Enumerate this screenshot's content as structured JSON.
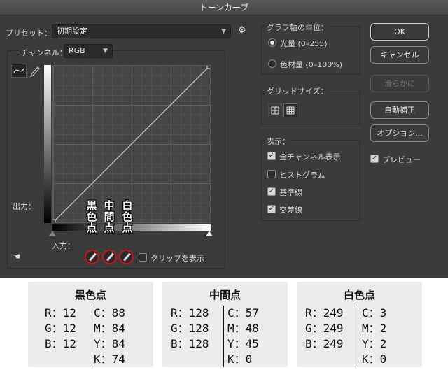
{
  "dialog": {
    "title": "トーンカーブ",
    "preset_label": "プリセット：",
    "preset_value": "初期設定",
    "channel_label": "チャンネル：",
    "channel_value": "RGB",
    "output_label": "出力：",
    "input_label": "入力：",
    "clip_label": "クリップを表示",
    "clip_checked": false
  },
  "graph_unit": {
    "title": "グラフ軸の単位：",
    "options": [
      {
        "label": "光量 (0–255)",
        "selected": true
      },
      {
        "label": "色材量 (0–100%)",
        "selected": false
      }
    ]
  },
  "grid_size": {
    "title": "グリッドサイズ：",
    "selected": "fine"
  },
  "display": {
    "title": "表示：",
    "options": [
      {
        "label": "全チャンネル表示",
        "checked": true
      },
      {
        "label": "ヒストグラム",
        "checked": false
      },
      {
        "label": "基準線",
        "checked": true
      },
      {
        "label": "交差線",
        "checked": true
      }
    ]
  },
  "buttons": {
    "ok": "OK",
    "cancel": "キャンセル",
    "smooth": "滑らかに",
    "auto": "自動補正",
    "options": "オプション...",
    "preview": "プレビュー",
    "preview_checked": true
  },
  "annotations": {
    "black": "黒色点",
    "mid": "中間点",
    "white": "白色点"
  },
  "cards": [
    {
      "title": "黒色点",
      "rgb": [
        "R：12",
        "G：12",
        "B：12"
      ],
      "cmyk": [
        "C：88",
        "M：84",
        "Y：84",
        "K：74"
      ]
    },
    {
      "title": "中間点",
      "rgb": [
        "R：128",
        "G：128",
        "B：128"
      ],
      "cmyk": [
        "C：57",
        "M：48",
        "Y：45",
        "K：0"
      ]
    },
    {
      "title": "白色点",
      "rgb": [
        "R：249",
        "G：249",
        "B：249"
      ],
      "cmyk": [
        "C：3",
        "M：2",
        "Y：2",
        "K：0"
      ]
    }
  ],
  "colors": {
    "dialog_bg": "#3b3b3b",
    "annotation_ring": "#d0101a",
    "card_bg": "#ebebeb"
  }
}
